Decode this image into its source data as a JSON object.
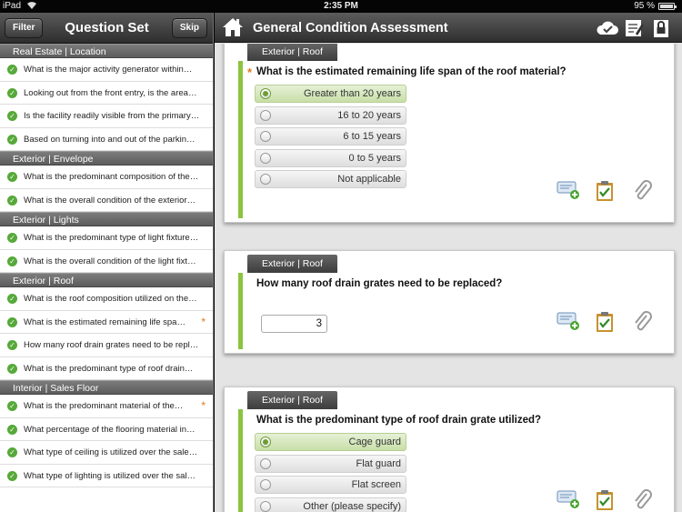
{
  "status": {
    "carrier": "iPad",
    "time": "2:35 PM",
    "battery": "95 %"
  },
  "sidebar": {
    "title": "Question Set",
    "filter_label": "Filter",
    "skip_label": "Skip",
    "sections": [
      {
        "name": "Real Estate | Location",
        "items": [
          {
            "text": "What is the major activity generator within…",
            "required": false
          },
          {
            "text": "Looking out from the front entry, is the area…",
            "required": false
          },
          {
            "text": "Is the facility readily visible from the primary…",
            "required": false
          },
          {
            "text": "Based on turning into and out of the parkin…",
            "required": false
          }
        ]
      },
      {
        "name": "Exterior | Envelope",
        "items": [
          {
            "text": "What is the predominant composition of the…",
            "required": false
          },
          {
            "text": "What is the overall condition of the exterior…",
            "required": false
          }
        ]
      },
      {
        "name": "Exterior | Lights",
        "items": [
          {
            "text": "What is the predominant type of light fixture…",
            "required": false
          },
          {
            "text": "What is the overall condition of the light fixt…",
            "required": false
          }
        ]
      },
      {
        "name": "Exterior | Roof",
        "items": [
          {
            "text": "What is the roof composition utilized on the…",
            "required": false
          },
          {
            "text": "What is the estimated remaining life spa…",
            "required": true
          },
          {
            "text": "How many roof drain grates need to be repl…",
            "required": false
          },
          {
            "text": "What is the predominant type of roof drain…",
            "required": false
          }
        ]
      },
      {
        "name": "Interior | Sales Floor",
        "items": [
          {
            "text": "What is the predominant material of the…",
            "required": true
          },
          {
            "text": "What percentage of the flooring material in…",
            "required": false
          },
          {
            "text": "What type of ceiling is utilized over the sale…",
            "required": false
          },
          {
            "text": "What type of lighting is utilized over the sal…",
            "required": false
          }
        ]
      }
    ]
  },
  "main": {
    "title": "General Condition Assessment",
    "cards": [
      {
        "tag": "Exterior | Roof",
        "question": "What is the estimated remaining life span of the roof material?",
        "required": true,
        "options": [
          "Greater than 20 years",
          "16 to 20 years",
          "6 to 15 years",
          "0 to 5 years",
          "Not applicable"
        ],
        "selected": 0
      },
      {
        "tag": "Exterior | Roof",
        "question": "How many roof drain grates need to be replaced?",
        "required": false,
        "value": "3"
      },
      {
        "tag": "Exterior | Roof",
        "question": "What is the predominant type of roof drain grate utilized?",
        "required": false,
        "options": [
          "Cage guard",
          "Flat guard",
          "Flat screen",
          "Other (please specify)"
        ],
        "selected": 0
      }
    ]
  },
  "colors": {
    "accent_green": "#8cc43f",
    "check_green": "#57a93a",
    "required_orange": "#e0781c"
  },
  "icons": [
    "home-icon",
    "cloud-sync-icon",
    "notes-icon",
    "lock-icon",
    "add-comment-icon",
    "clipboard-icon",
    "paperclip-icon"
  ]
}
